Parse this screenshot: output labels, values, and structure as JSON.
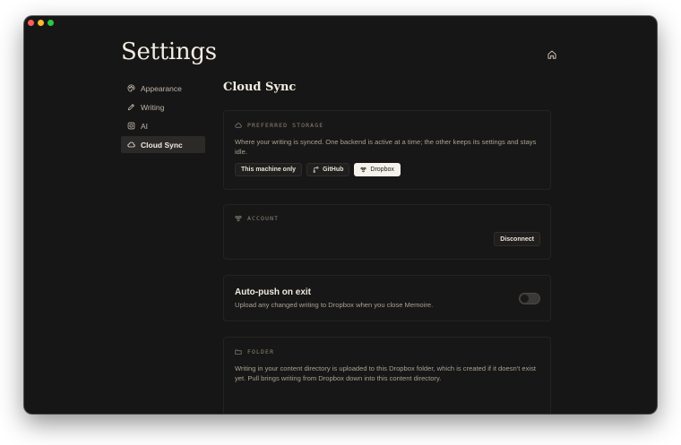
{
  "page": {
    "title": "Settings"
  },
  "sidebar": {
    "items": [
      {
        "label": "Appearance",
        "icon": "palette-icon"
      },
      {
        "label": "Writing",
        "icon": "pen-icon"
      },
      {
        "label": "AI",
        "icon": "instagram-like-square-icon"
      },
      {
        "label": "Cloud Sync",
        "icon": "cloud-icon",
        "active": true
      }
    ]
  },
  "section": {
    "title": "Cloud Sync"
  },
  "storage": {
    "label": "PREFERRED STORAGE",
    "description": "Where your writing is synced. One backend is active at a time; the other keeps its settings and stays idle.",
    "options": [
      "This machine only",
      "GitHub",
      "Dropbox"
    ],
    "selected": "Dropbox"
  },
  "account": {
    "label": "ACCOUNT",
    "disconnect_label": "Disconnect"
  },
  "autopush": {
    "title": "Auto-push on exit",
    "description": "Upload any changed writing to Dropbox when you close Memoire.",
    "enabled": false
  },
  "folder": {
    "label": "FOLDER",
    "description": "Writing in your content directory is uploaded to this Dropbox folder, which is created if it doesn't exist yet. Pull brings writing from Dropbox down into this content directory."
  },
  "colors": {
    "window_bg": "#171616",
    "accent_selected": "#f5f2eb",
    "text_primary": "#f2ede2",
    "text_muted": "#a8a191"
  }
}
